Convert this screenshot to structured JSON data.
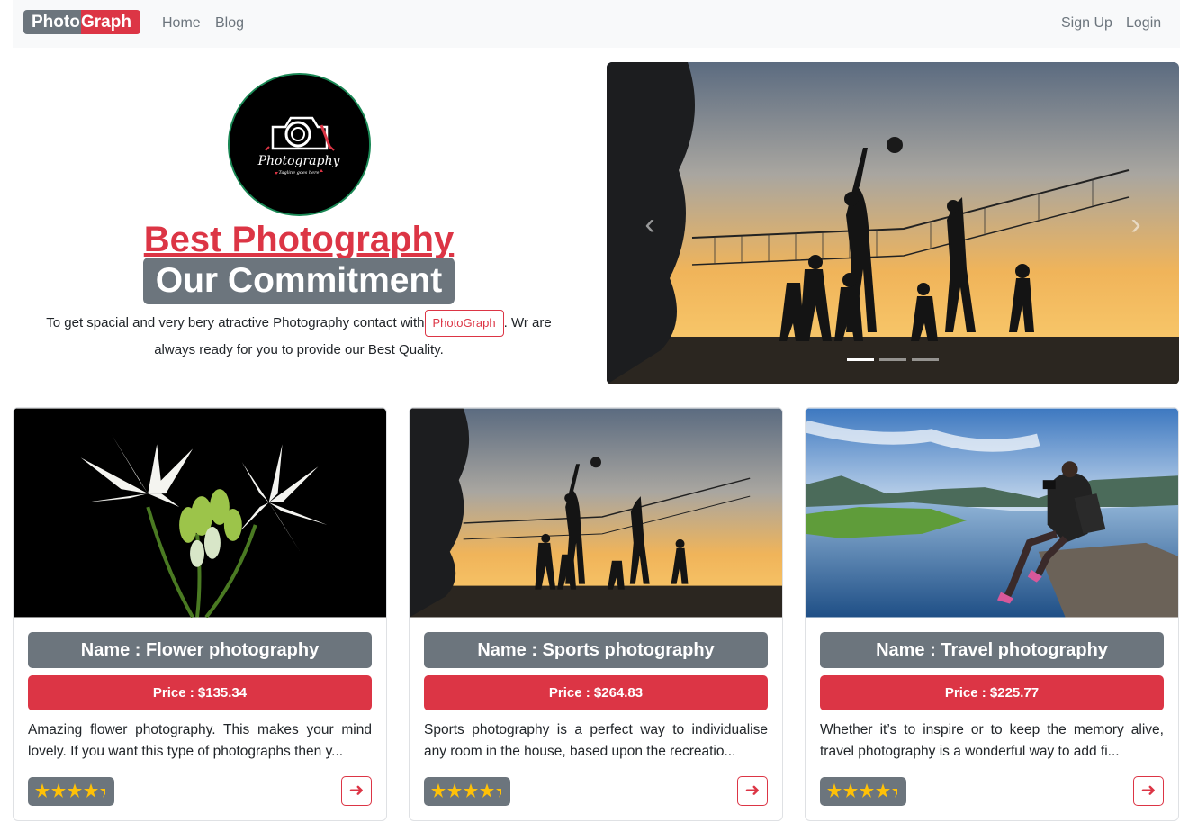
{
  "navbar": {
    "brand_part1": "Photo",
    "brand_part2": "Graph",
    "links": [
      "Home",
      "Blog"
    ],
    "right_links": [
      "Sign Up",
      "Login"
    ]
  },
  "hero": {
    "logo_text": "Photography",
    "logo_tagline": "Tagline goes here",
    "title": "Best Photography",
    "subtitle": "Our Commitment",
    "text_before": "To get spacial and very bery atractive Photography contact with",
    "tag_button": "PhotoGraph",
    "text_after": ". Wr are always ready for you to provide our Best Quality."
  },
  "carousel": {
    "prev_icon": "chevron-left-icon",
    "next_icon": "chevron-right-icon",
    "slide_count": 3,
    "active_index": 0
  },
  "cards": [
    {
      "name": "Name : Flower photography",
      "price": "Price : $135.34",
      "description": "Amazing flower photography. This makes your mind lovely. If you want this type of photographs then y...",
      "rating": 4.5
    },
    {
      "name": "Name : Sports photography",
      "price": "Price : $264.83",
      "description": "Sports photography is a perfect way to individualise any room in the house, based upon the recreatio...",
      "rating": 4.5
    },
    {
      "name": "Name : Travel photography",
      "price": "Price : $225.77",
      "description": "Whether it’s to inspire or to keep the memory alive, travel photography is a wonderful way to add fi...",
      "rating": 4.5
    }
  ],
  "colors": {
    "primary_red": "#dc3545",
    "secondary_gray": "#6c757d",
    "star_yellow": "#ffc107"
  }
}
